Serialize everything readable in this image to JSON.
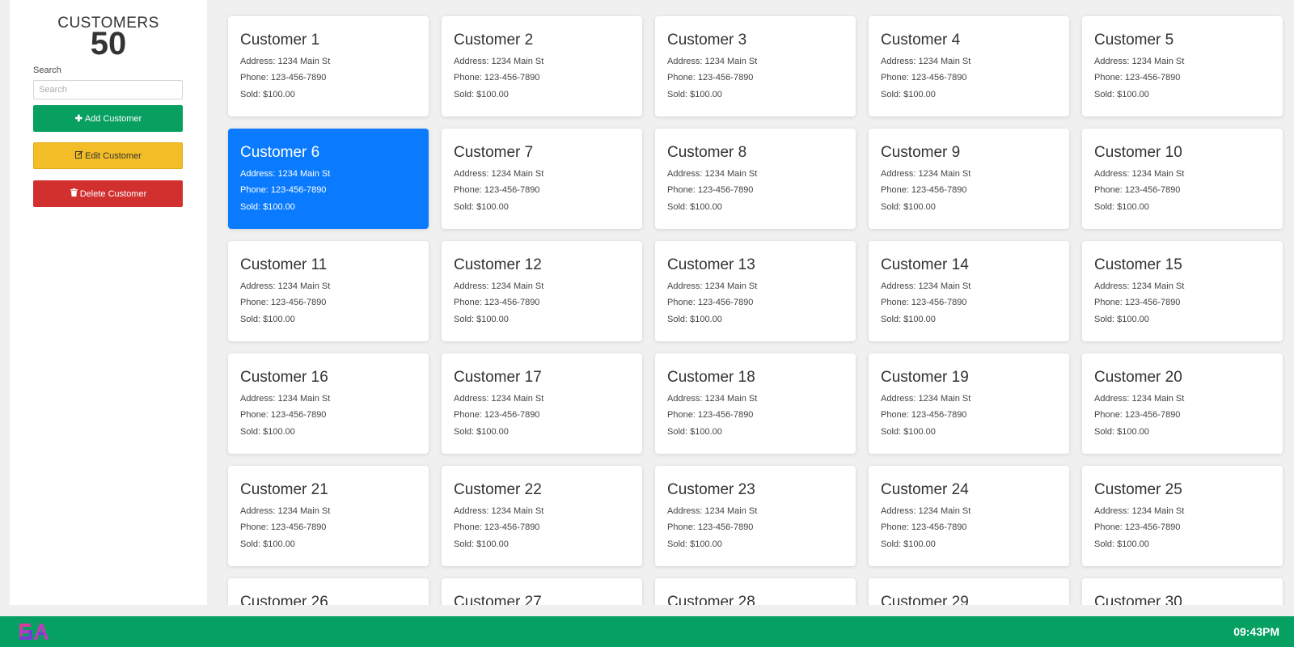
{
  "sidebar": {
    "title": "CUSTOMERS",
    "count": "50",
    "search_label": "Search",
    "search_placeholder": "Search",
    "search_value": "",
    "add_label": "Add Customer",
    "edit_label": "Edit Customer",
    "delete_label": "Delete Customer"
  },
  "customers": [
    {
      "name": "Customer 1",
      "address": "Address: 1234 Main St",
      "phone": "Phone: 123-456-7890",
      "sold": "Sold: $100.00"
    },
    {
      "name": "Customer 2",
      "address": "Address: 1234 Main St",
      "phone": "Phone: 123-456-7890",
      "sold": "Sold: $100.00"
    },
    {
      "name": "Customer 3",
      "address": "Address: 1234 Main St",
      "phone": "Phone: 123-456-7890",
      "sold": "Sold: $100.00"
    },
    {
      "name": "Customer 4",
      "address": "Address: 1234 Main St",
      "phone": "Phone: 123-456-7890",
      "sold": "Sold: $100.00"
    },
    {
      "name": "Customer 5",
      "address": "Address: 1234 Main St",
      "phone": "Phone: 123-456-7890",
      "sold": "Sold: $100.00"
    },
    {
      "name": "Customer 6",
      "address": "Address: 1234 Main St",
      "phone": "Phone: 123-456-7890",
      "sold": "Sold: $100.00"
    },
    {
      "name": "Customer 7",
      "address": "Address: 1234 Main St",
      "phone": "Phone: 123-456-7890",
      "sold": "Sold: $100.00"
    },
    {
      "name": "Customer 8",
      "address": "Address: 1234 Main St",
      "phone": "Phone: 123-456-7890",
      "sold": "Sold: $100.00"
    },
    {
      "name": "Customer 9",
      "address": "Address: 1234 Main St",
      "phone": "Phone: 123-456-7890",
      "sold": "Sold: $100.00"
    },
    {
      "name": "Customer 10",
      "address": "Address: 1234 Main St",
      "phone": "Phone: 123-456-7890",
      "sold": "Sold: $100.00"
    },
    {
      "name": "Customer 11",
      "address": "Address: 1234 Main St",
      "phone": "Phone: 123-456-7890",
      "sold": "Sold: $100.00"
    },
    {
      "name": "Customer 12",
      "address": "Address: 1234 Main St",
      "phone": "Phone: 123-456-7890",
      "sold": "Sold: $100.00"
    },
    {
      "name": "Customer 13",
      "address": "Address: 1234 Main St",
      "phone": "Phone: 123-456-7890",
      "sold": "Sold: $100.00"
    },
    {
      "name": "Customer 14",
      "address": "Address: 1234 Main St",
      "phone": "Phone: 123-456-7890",
      "sold": "Sold: $100.00"
    },
    {
      "name": "Customer 15",
      "address": "Address: 1234 Main St",
      "phone": "Phone: 123-456-7890",
      "sold": "Sold: $100.00"
    },
    {
      "name": "Customer 16",
      "address": "Address: 1234 Main St",
      "phone": "Phone: 123-456-7890",
      "sold": "Sold: $100.00"
    },
    {
      "name": "Customer 17",
      "address": "Address: 1234 Main St",
      "phone": "Phone: 123-456-7890",
      "sold": "Sold: $100.00"
    },
    {
      "name": "Customer 18",
      "address": "Address: 1234 Main St",
      "phone": "Phone: 123-456-7890",
      "sold": "Sold: $100.00"
    },
    {
      "name": "Customer 19",
      "address": "Address: 1234 Main St",
      "phone": "Phone: 123-456-7890",
      "sold": "Sold: $100.00"
    },
    {
      "name": "Customer 20",
      "address": "Address: 1234 Main St",
      "phone": "Phone: 123-456-7890",
      "sold": "Sold: $100.00"
    },
    {
      "name": "Customer 21",
      "address": "Address: 1234 Main St",
      "phone": "Phone: 123-456-7890",
      "sold": "Sold: $100.00"
    },
    {
      "name": "Customer 22",
      "address": "Address: 1234 Main St",
      "phone": "Phone: 123-456-7890",
      "sold": "Sold: $100.00"
    },
    {
      "name": "Customer 23",
      "address": "Address: 1234 Main St",
      "phone": "Phone: 123-456-7890",
      "sold": "Sold: $100.00"
    },
    {
      "name": "Customer 24",
      "address": "Address: 1234 Main St",
      "phone": "Phone: 123-456-7890",
      "sold": "Sold: $100.00"
    },
    {
      "name": "Customer 25",
      "address": "Address: 1234 Main St",
      "phone": "Phone: 123-456-7890",
      "sold": "Sold: $100.00"
    },
    {
      "name": "Customer 26",
      "address": "",
      "phone": "",
      "sold": ""
    },
    {
      "name": "Customer 27",
      "address": "",
      "phone": "",
      "sold": ""
    },
    {
      "name": "Customer 28",
      "address": "",
      "phone": "",
      "sold": ""
    },
    {
      "name": "Customer 29",
      "address": "",
      "phone": "",
      "sold": ""
    },
    {
      "name": "Customer 30",
      "address": "",
      "phone": "",
      "sold": ""
    }
  ],
  "selected_customer": "Customer 6",
  "colors": {
    "accent": "#0a7bff",
    "add": "#08a060",
    "edit": "#f2bd26",
    "delete": "#d22f2f",
    "footer": "#06a063"
  },
  "icons": {
    "add": "plus-icon",
    "edit": "edit-icon",
    "delete": "trash-icon",
    "logo": "brand-logo"
  },
  "footer": {
    "clock": "09:43PM"
  }
}
